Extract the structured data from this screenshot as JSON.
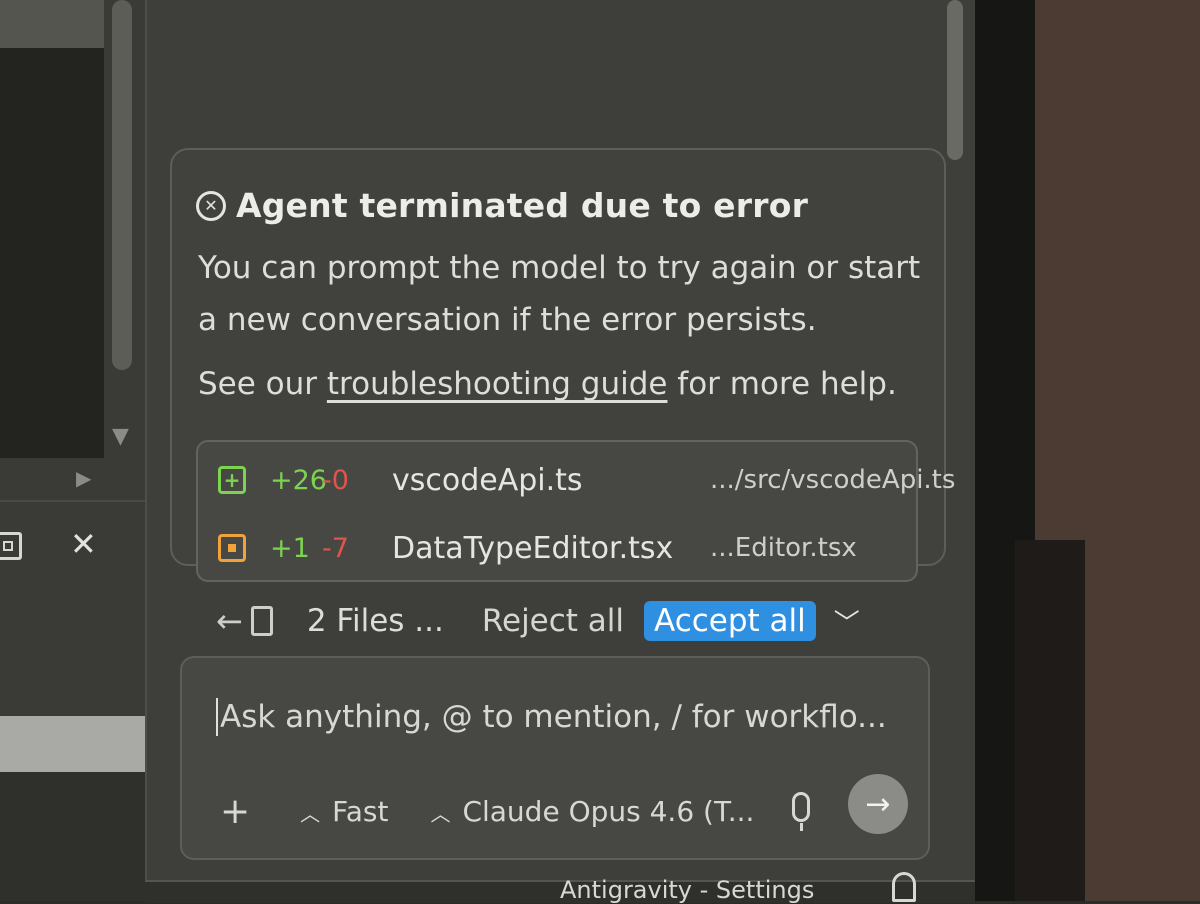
{
  "error": {
    "title": "Agent terminated due to error",
    "message": "You can prompt the model to try again or start a new conversation if the error persists.",
    "help_prefix": "See our ",
    "help_link": "troubleshooting guide",
    "help_suffix": " for more help."
  },
  "files": [
    {
      "status": "added",
      "additions": "+26",
      "deletions": "-0",
      "name": "vscodeApi.ts",
      "path": ".../src/vscodeApi.ts"
    },
    {
      "status": "modified",
      "additions": "+1",
      "deletions": "-7",
      "name": "DataTypeEditor.tsx",
      "path": "...Editor.tsx"
    }
  ],
  "actions": {
    "files_label": "2 Files ...",
    "reject_label": "Reject all",
    "accept_label": "Accept all"
  },
  "input": {
    "placeholder": "Ask anything, @ to mention, / for workflo...",
    "mode": "Fast",
    "model": "Claude Opus 4.6 (T..."
  },
  "status_bar": {
    "title": "Antigravity - Settings"
  },
  "colors": {
    "accent": "#2f8fe0",
    "added": "#7bd44f",
    "deleted": "#e0544b",
    "modified": "#f0a33b"
  }
}
